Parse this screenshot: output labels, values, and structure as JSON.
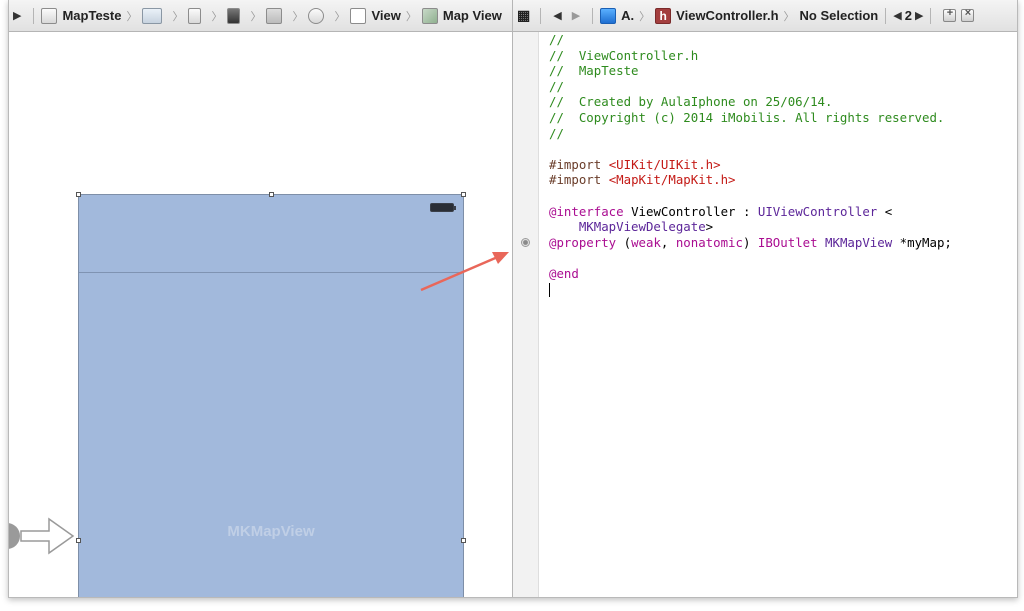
{
  "left_jumpbar": {
    "project": "MapTeste",
    "view": "View",
    "map_view": "Map View"
  },
  "right_jumpbar": {
    "assistant": "A.",
    "file": "ViewController.h",
    "selection": "No Selection",
    "counter": "2"
  },
  "canvas": {
    "map_view_label": "MKMapView"
  },
  "editor": {
    "lines": [
      {
        "parts": [
          {
            "t": "//",
            "c": "cmt"
          }
        ]
      },
      {
        "parts": [
          {
            "t": "//  ViewController.h",
            "c": "cmt"
          }
        ]
      },
      {
        "parts": [
          {
            "t": "//  MapTeste",
            "c": "cmt"
          }
        ]
      },
      {
        "parts": [
          {
            "t": "//",
            "c": "cmt"
          }
        ]
      },
      {
        "parts": [
          {
            "t": "//  Created by AulaIphone on 25/06/14.",
            "c": "cmt"
          }
        ]
      },
      {
        "parts": [
          {
            "t": "//  Copyright (c) 2014 iMobilis. All rights reserved.",
            "c": "cmt"
          }
        ]
      },
      {
        "parts": [
          {
            "t": "//",
            "c": "cmt"
          }
        ]
      },
      {
        "parts": []
      },
      {
        "parts": [
          {
            "t": "#import ",
            "c": "dir"
          },
          {
            "t": "<UIKit/UIKit.h>",
            "c": "str"
          }
        ]
      },
      {
        "parts": [
          {
            "t": "#import ",
            "c": "dir"
          },
          {
            "t": "<MapKit/MapKit.h>",
            "c": "str"
          }
        ]
      },
      {
        "parts": []
      },
      {
        "parts": [
          {
            "t": "@interface",
            "c": "kw"
          },
          {
            "t": " ViewController : ",
            "c": ""
          },
          {
            "t": "UIViewController",
            "c": "cls"
          },
          {
            "t": " <",
            "c": ""
          }
        ]
      },
      {
        "parts": [
          {
            "t": "    MKMapViewDelegate",
            "c": "cls"
          },
          {
            "t": ">",
            "c": ""
          }
        ]
      },
      {
        "parts": [
          {
            "t": "@property",
            "c": "kw"
          },
          {
            "t": " (",
            "c": ""
          },
          {
            "t": "weak",
            "c": "kw"
          },
          {
            "t": ", ",
            "c": ""
          },
          {
            "t": "nonatomic",
            "c": "kw"
          },
          {
            "t": ") ",
            "c": ""
          },
          {
            "t": "IBOutlet",
            "c": "kw"
          },
          {
            "t": " ",
            "c": ""
          },
          {
            "t": "MKMapView",
            "c": "cls"
          },
          {
            "t": " *myMap;",
            "c": ""
          }
        ]
      },
      {
        "parts": []
      },
      {
        "parts": [
          {
            "t": "@end",
            "c": "kw"
          }
        ]
      },
      {
        "parts": [],
        "cursor": true
      }
    ]
  },
  "icons": {
    "arrow_color": "#e9675a",
    "device_color": "#a2b9dc"
  }
}
